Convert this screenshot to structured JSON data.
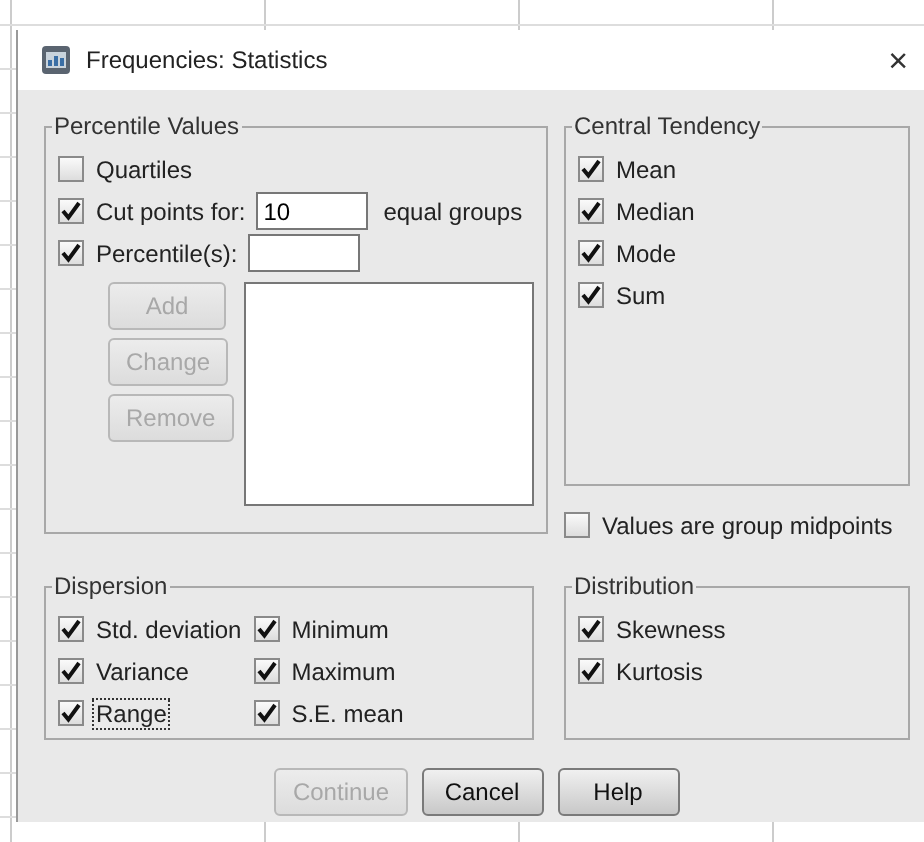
{
  "window": {
    "title": "Frequencies: Statistics",
    "close": "×"
  },
  "percentile_values": {
    "title": "Percentile Values",
    "options": [
      {
        "kind": "check",
        "label": "Quartiles",
        "checked": false
      },
      {
        "kind": "check-input",
        "label": "Cut points for:",
        "checked": true,
        "value": "10",
        "suffix": "equal groups"
      },
      {
        "kind": "check-input",
        "label": "Percentile(s):",
        "checked": true
      }
    ],
    "buttons": [
      {
        "label": "Add",
        "disabled": true
      },
      {
        "label": "Change",
        "disabled": true
      },
      {
        "label": "Remove",
        "disabled": true
      }
    ]
  },
  "central_tendency": {
    "title": "Central Tendency",
    "options": [
      {
        "label": "Mean",
        "checked": true
      },
      {
        "label": "Median",
        "checked": true
      },
      {
        "label": "Mode",
        "checked": true
      },
      {
        "label": "Sum",
        "checked": true
      }
    ]
  },
  "group_midpoints": {
    "label": "Values are group midpoints",
    "checked": false
  },
  "dispersion": {
    "title": "Dispersion",
    "options": [
      {
        "label": "Std. deviation",
        "checked": true,
        "focused": false
      },
      {
        "label": "Minimum",
        "checked": true,
        "focused": false
      },
      {
        "label": "Variance",
        "checked": true,
        "focused": false
      },
      {
        "label": "Maximum",
        "checked": true,
        "focused": false
      },
      {
        "label": "Range",
        "checked": true,
        "focused": true
      },
      {
        "label": "S.E. mean",
        "checked": true,
        "focused": false
      }
    ]
  },
  "distribution": {
    "title": "Distribution",
    "options": [
      {
        "label": "Skewness",
        "checked": true
      },
      {
        "label": "Kurtosis",
        "checked": true
      }
    ]
  },
  "buttons": [
    {
      "label": "Continue",
      "disabled": true
    },
    {
      "label": "Cancel",
      "disabled": false
    },
    {
      "label": "Help",
      "disabled": false
    }
  ]
}
